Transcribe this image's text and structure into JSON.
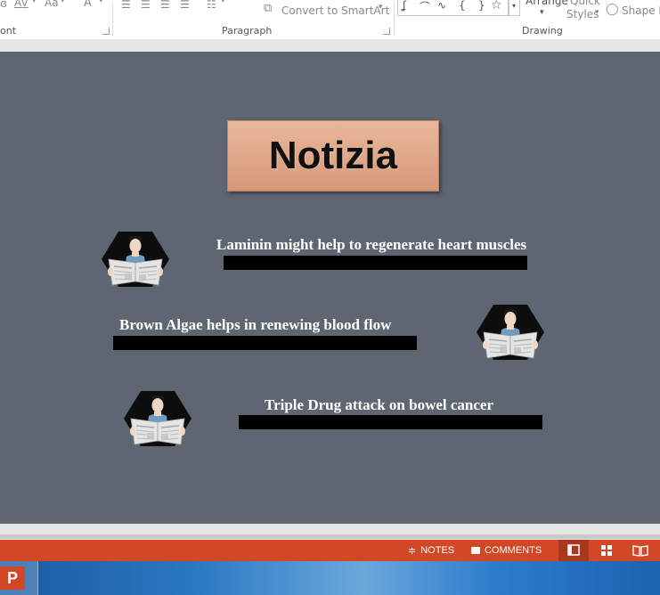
{
  "ribbon": {
    "font_group_label": "ont",
    "paragraph_group_label": "Paragraph",
    "drawing_group_label": "Drawing",
    "convert_smartart_label": "Convert to SmartArt",
    "arrange_label": "Arrange",
    "quick_styles_line1": "Quick",
    "quick_styles_line2": "Styles",
    "shape_effects_label": "Shape E",
    "change_case_label": "Aa",
    "font_color_label": "A",
    "char_spacing_label": "AV"
  },
  "slide": {
    "title": "Notizia",
    "headlines": [
      "Laminin might help to regenerate heart muscles",
      "Brown Algae helps in renewing blood flow",
      "Triple Drug attack on bowel cancer"
    ],
    "colors": {
      "background": "#5e6672",
      "title_fill": "#e2ad90",
      "bar": "#000000"
    }
  },
  "statusbar": {
    "notes_label": "NOTES",
    "comments_label": "COMMENTS",
    "color": "#d24726"
  },
  "taskbar": {
    "app_icon_letter": "P"
  }
}
